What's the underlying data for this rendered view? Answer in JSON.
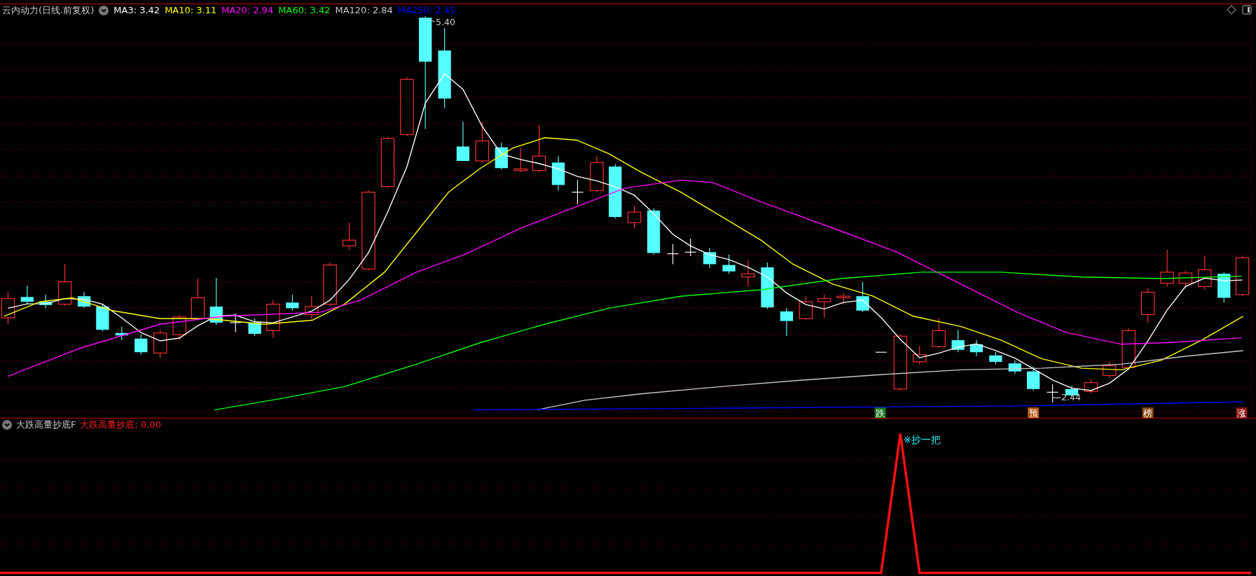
{
  "title": "云内动力(日线.前复权)",
  "ma_legend": [
    {
      "label": "MA3: 3.42",
      "color": "#ffffff"
    },
    {
      "label": "MA10: 3.11",
      "color": "#ffff00"
    },
    {
      "label": "MA20: 2.94",
      "color": "#ff00ff"
    },
    {
      "label": "MA60: 3.42",
      "color": "#00ff00"
    },
    {
      "label": "MA120: 2.84",
      "color": "#c8c8c8"
    },
    {
      "label": "MA250: 2.45",
      "color": "#0000ff"
    }
  ],
  "price_labels": [
    {
      "kind": "high",
      "text": "5.40"
    },
    {
      "kind": "low",
      "text": "2.44"
    }
  ],
  "signal_tags": [
    {
      "text": "跌",
      "color": "#17731a"
    },
    {
      "text": "预",
      "color": "#b5520c"
    },
    {
      "text": "榜",
      "color": "#8c4b12"
    },
    {
      "text": "涨",
      "color": "#8c1212"
    }
  ],
  "indicator": {
    "name": "大跌高量抄底F",
    "reading": "大跌高量抄底: 0.00",
    "signal_label": "※抄一把"
  }
}
